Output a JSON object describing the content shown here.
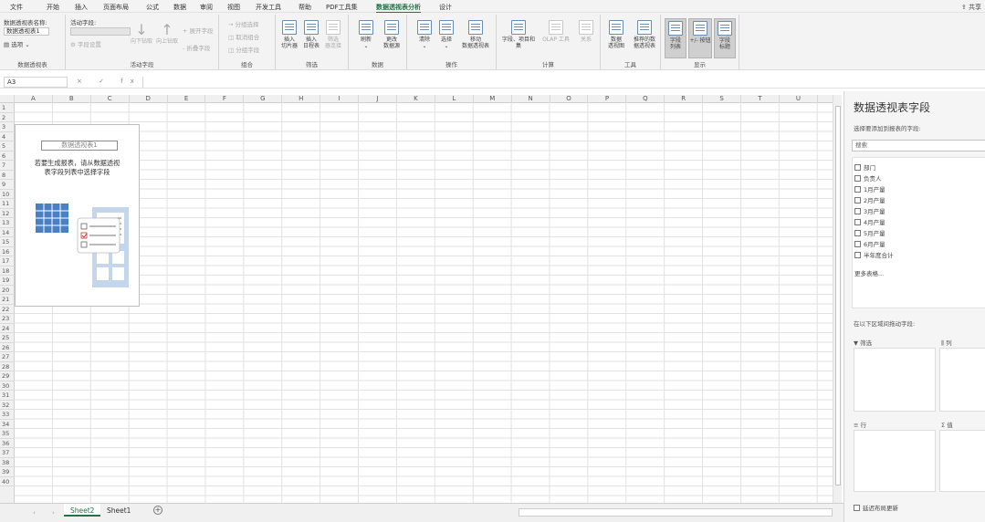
{
  "menu": {
    "tabs": [
      "文件",
      "开始",
      "插入",
      "页面布局",
      "公式",
      "数据",
      "审阅",
      "视图",
      "开发工具",
      "帮助",
      "PDF工具集",
      "数据透视表分析",
      "设计"
    ],
    "active_tab": "数据透视表分析",
    "share": "共享"
  },
  "ribbon": {
    "pivot": {
      "name_label": "数据透视表名称:",
      "name_value": "数据透视表1",
      "options": "选项",
      "group": "数据透视表"
    },
    "active_field": {
      "label": "活动字段:",
      "field_settings": "字段设置",
      "drill_down": "向下钻取",
      "drill_up": "向上钻取",
      "expand": "展开字段",
      "collapse": "折叠字段",
      "group": "活动字段"
    },
    "grouping": {
      "group_selection": "分组选择",
      "ungroup": "取消组合",
      "group_field": "分组字段",
      "group": "组合"
    },
    "filter": {
      "slicer": "插入\n切片器",
      "timeline": "插入\n日程表",
      "connections": "筛选\n器连接",
      "group": "筛选"
    },
    "data": {
      "refresh": "刷新",
      "change_source": "更改\n数据源",
      "group": "数据"
    },
    "actions": {
      "clear": "清除",
      "select": "选择",
      "move": "移动\n数据透视表",
      "group": "操作"
    },
    "calculations": {
      "fields_items": "字段、项目和\n集",
      "olap": "OLAP 工具",
      "relationships": "关系",
      "group": "计算"
    },
    "tools": {
      "pivotchart": "数据\n透视图",
      "recommended": "推荐的数\n据透视表",
      "group": "工具"
    },
    "show": {
      "field_list": "字段\n列表",
      "buttons": "+/- 按钮",
      "headers": "字段\n标题",
      "group": "显示"
    }
  },
  "formula": {
    "name_box": "A3",
    "icons": "× ✓ fx"
  },
  "grid": {
    "columns": [
      "A",
      "B",
      "C",
      "D",
      "E",
      "F",
      "G",
      "H",
      "I",
      "J",
      "K",
      "L",
      "M",
      "N",
      "O",
      "P",
      "Q",
      "R",
      "S",
      "T",
      "U"
    ],
    "rows": [
      "1",
      "2",
      "3",
      "4",
      "5",
      "6",
      "7",
      "8",
      "9",
      "10",
      "11",
      "12",
      "13",
      "14",
      "15",
      "16",
      "17",
      "18",
      "19",
      "20",
      "21",
      "22",
      "23",
      "24",
      "25",
      "26",
      "27",
      "28",
      "29",
      "30",
      "31",
      "32",
      "33",
      "34",
      "35",
      "36",
      "37",
      "38",
      "39",
      "40"
    ],
    "placeholder_title": "数据透视表1",
    "placeholder_text": "若要生成报表，请从数据透视\n表字段列表中选择字段"
  },
  "sheets": {
    "tabs": [
      "Sheet2",
      "Sheet1"
    ],
    "active": "Sheet2"
  },
  "field_pane": {
    "title": "数据透视表字段",
    "subtitle": "选择要添加到报表的字段:",
    "search_placeholder": "搜索",
    "fields": [
      "部门",
      "负责人",
      "1月产量",
      "2月产量",
      "3月产量",
      "4月产量",
      "5月产量",
      "6月产量",
      "半年度合计"
    ],
    "more_tables": "更多表格...",
    "drag_label": "在以下区域间拖动字段:",
    "areas": {
      "filters": "筛选",
      "columns": "列",
      "rows": "行",
      "values": "值"
    },
    "defer": "延迟布局更新"
  }
}
